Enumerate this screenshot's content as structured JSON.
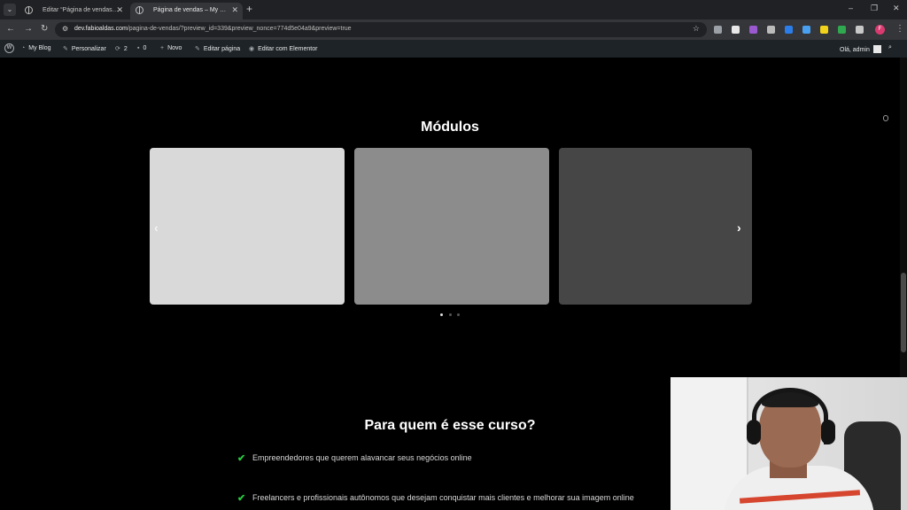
{
  "browser": {
    "tabs": [
      {
        "label": "Editar “Página de vendas” com",
        "active": false
      },
      {
        "label": "Página de vendas – My Blog",
        "active": true
      }
    ],
    "new_tab_icon": "plus-icon",
    "url_host": "dev.fabioaldas.com",
    "url_path": "/pagina-de-vendas/?preview_id=339&preview_nonce=774d5e04a9&preview=true",
    "profile_initial": "F",
    "extension_colors": [
      "#9aa0a6",
      "#e8e8e8",
      "#9b59d0",
      "#bbbbbb",
      "#2b7de9",
      "#4aa0f0",
      "#f2d21b",
      "#2fa84f",
      "#c8c8c8"
    ]
  },
  "adminbar": {
    "site": "My Blog",
    "customize": "Personalizar",
    "updates_count": "2",
    "comments_count": "0",
    "new": "Novo",
    "edit_page": "Editar página",
    "edit_elementor": "Editar com Elementor",
    "greeting": "Olá, admin"
  },
  "page": {
    "modules_title": "Módulos",
    "carousel": {
      "cards": [
        {
          "color": "#d9d9d9"
        },
        {
          "color": "#8c8c8c"
        },
        {
          "color": "#464646"
        }
      ],
      "prev_icon": "chevron-left-icon",
      "next_icon": "chevron-right-icon",
      "dots": 3,
      "active_dot": 1
    },
    "audience_title": "Para quem é esse curso?",
    "audience_items": [
      "Empreendedores que querem alavancar seus negócios online",
      "Freelancers e profissionais autônomos que desejam conquistar mais clientes e melhorar sua imagem online"
    ],
    "check_color": "#28c840"
  }
}
